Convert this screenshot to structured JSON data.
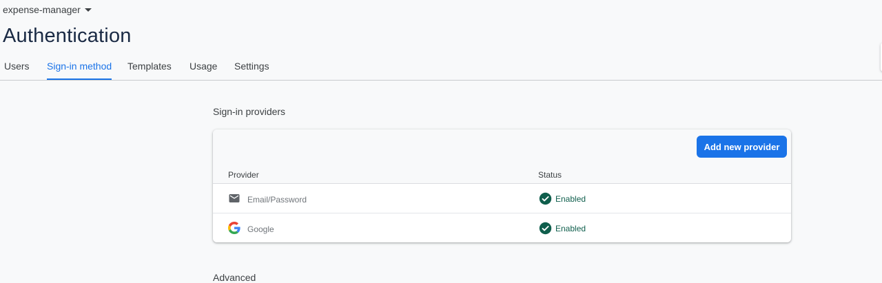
{
  "header": {
    "project_name": "expense-manager",
    "page_title": "Authentication"
  },
  "tabs": [
    {
      "label": "Users",
      "active": false
    },
    {
      "label": "Sign-in method",
      "active": true
    },
    {
      "label": "Templates",
      "active": false
    },
    {
      "label": "Usage",
      "active": false
    },
    {
      "label": "Settings",
      "active": false
    }
  ],
  "sign_in_providers": {
    "section_title": "Sign-in providers",
    "add_button_label": "Add new provider",
    "columns": {
      "provider": "Provider",
      "status": "Status"
    },
    "rows": [
      {
        "provider": "Email/Password",
        "icon": "envelope-icon",
        "status": "Enabled"
      },
      {
        "provider": "Google",
        "icon": "google-icon",
        "status": "Enabled"
      }
    ]
  },
  "next_section": {
    "partial_title": "Advanced"
  },
  "colors": {
    "accent": "#1a73e8",
    "title": "#1a2a44",
    "enabled": "#0f5e4c",
    "background": "#f8f9fa"
  }
}
